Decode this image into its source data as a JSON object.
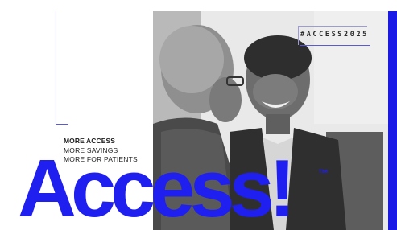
{
  "hashtag": "#ACCESS2025",
  "taglines": {
    "line1": "MORE ACCESS",
    "line2": "MORE SAVINGS",
    "line3": "MORE FOR PATIENTS"
  },
  "title": "Access!",
  "trademark": "™",
  "colors": {
    "brand_blue": "#1f1ff0",
    "accent_line": "#5a5ad8",
    "background": "#ffffff"
  },
  "photo": {
    "description_icon": "two-men-conversation-photo-icon"
  }
}
